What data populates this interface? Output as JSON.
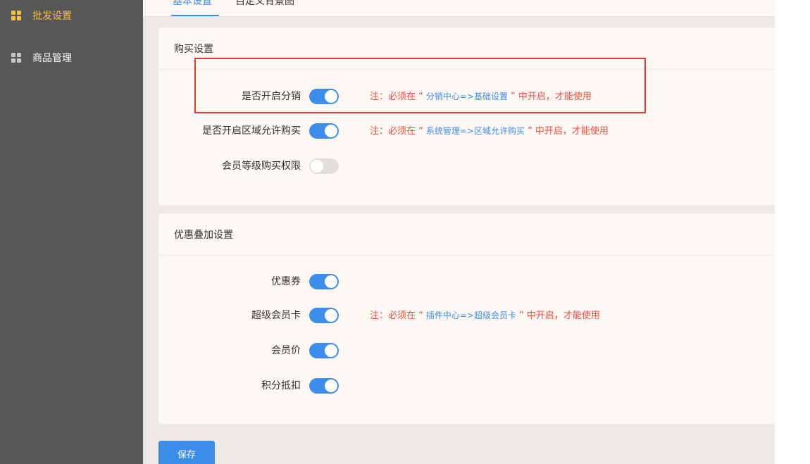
{
  "sidebar": {
    "items": [
      {
        "label": "批发设置",
        "icon": "grid-icon",
        "active": true
      },
      {
        "label": "商品管理",
        "icon": "grid-icon",
        "active": false
      }
    ]
  },
  "tabs": [
    {
      "label": "基本设置",
      "active": true
    },
    {
      "label": "自定义背景图",
      "active": false
    }
  ],
  "purchase": {
    "title": "购买设置",
    "rows": [
      {
        "label": "是否开启分销",
        "enabled": true,
        "note_prefix": "注：必须在 “",
        "note_path": "分销中心=>基础设置",
        "note_suffix": "” 中开启，才能使用"
      },
      {
        "label": "是否开启区域允许购买",
        "enabled": true,
        "note_prefix": "注：必须在 “",
        "note_path": "系统管理=>区域允许购买",
        "note_suffix": "” 中开启，才能使用"
      },
      {
        "label": "会员等级购买权限",
        "enabled": false
      }
    ]
  },
  "discount": {
    "title": "优惠叠加设置",
    "rows": [
      {
        "label": "优惠券",
        "enabled": true
      },
      {
        "label": "超级会员卡",
        "enabled": true,
        "note_prefix": "注：必须在 “",
        "note_path": "插件中心=>超级会员卡",
        "note_suffix": "” 中开启，才能使用"
      },
      {
        "label": "会员价",
        "enabled": true
      },
      {
        "label": "积分抵扣",
        "enabled": true
      }
    ]
  },
  "save_label": "保存",
  "colors": {
    "accent": "#3c8dea",
    "warning": "#ee4b3c",
    "sidebar_bg": "#575757",
    "sidebar_active": "#f7c042"
  }
}
